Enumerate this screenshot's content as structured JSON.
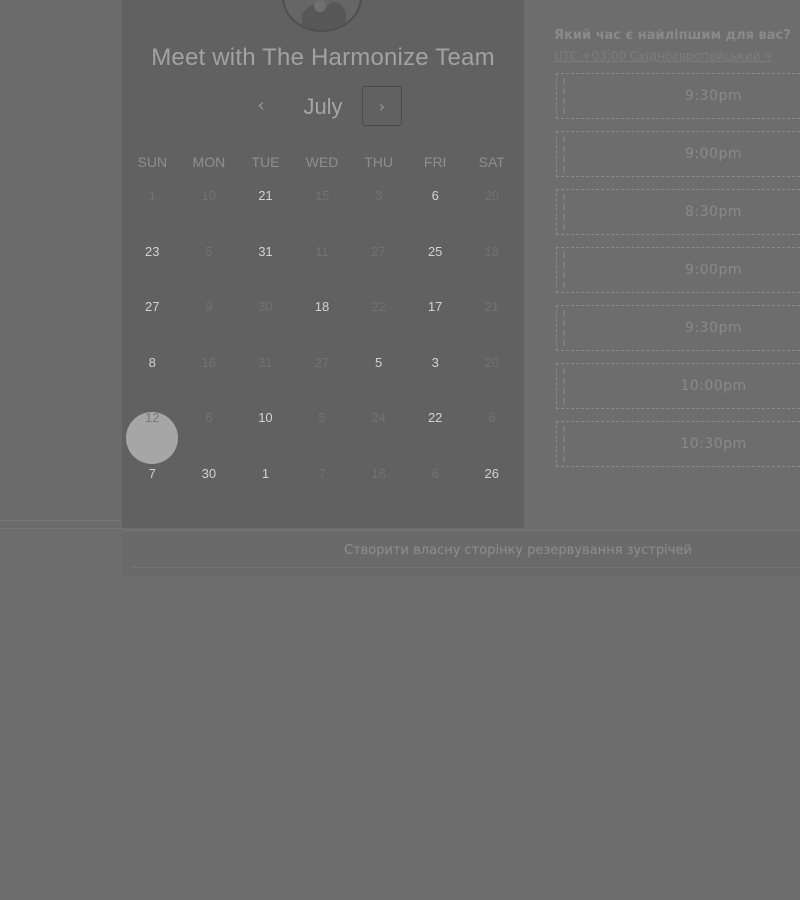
{
  "booking": {
    "title": "Meet with The Harmonize Team",
    "month": "July",
    "prev_icon": "‹",
    "next_icon": "›"
  },
  "weekdays": [
    "SUN",
    "MON",
    "TUE",
    "WED",
    "THU",
    "FRI",
    "SAT"
  ],
  "weeks": [
    [
      {
        "d": "1",
        "s": "dim"
      },
      {
        "d": "10",
        "s": "dim"
      },
      {
        "d": "21",
        "s": "bright"
      },
      {
        "d": "15",
        "s": "dim"
      },
      {
        "d": "3",
        "s": "dim"
      },
      {
        "d": "6",
        "s": "bright"
      },
      {
        "d": "20",
        "s": "dim"
      }
    ],
    [
      {
        "d": "23",
        "s": "bright"
      },
      {
        "d": "5",
        "s": "dim"
      },
      {
        "d": "31",
        "s": "bright"
      },
      {
        "d": "11",
        "s": "dim"
      },
      {
        "d": "27",
        "s": "dim"
      },
      {
        "d": "25",
        "s": "bright"
      },
      {
        "d": "18",
        "s": "dim"
      }
    ],
    [
      {
        "d": "27",
        "s": "bright"
      },
      {
        "d": "9",
        "s": "dim"
      },
      {
        "d": "30",
        "s": "dim"
      },
      {
        "d": "18",
        "s": "bright"
      },
      {
        "d": "22",
        "s": "dim"
      },
      {
        "d": "17",
        "s": "bright"
      },
      {
        "d": "21",
        "s": "dim"
      }
    ],
    [
      {
        "d": "8",
        "s": "bright"
      },
      {
        "d": "16",
        "s": "dim"
      },
      {
        "d": "31",
        "s": "dim"
      },
      {
        "d": "27",
        "s": "dim"
      },
      {
        "d": "5",
        "s": "bright"
      },
      {
        "d": "3",
        "s": "bright"
      },
      {
        "d": "20",
        "s": "dim"
      }
    ],
    [
      {
        "d": "12",
        "s": "selected"
      },
      {
        "d": "6",
        "s": "dim"
      },
      {
        "d": "10",
        "s": "bright"
      },
      {
        "d": "5",
        "s": "dim"
      },
      {
        "d": "24",
        "s": "dim"
      },
      {
        "d": "22",
        "s": "bright"
      },
      {
        "d": "6",
        "s": "dim"
      }
    ],
    [
      {
        "d": "7",
        "s": "bright"
      },
      {
        "d": "30",
        "s": "bright"
      },
      {
        "d": "1",
        "s": "bright"
      },
      {
        "d": "7",
        "s": "dim"
      },
      {
        "d": "18",
        "s": "dim"
      },
      {
        "d": "6",
        "s": "dim"
      },
      {
        "d": "26",
        "s": "bright"
      }
    ]
  ],
  "times": {
    "heading": "Який час є найліпшим для вас?",
    "timezone": "UTC +03:00 Східноєвропейський ч",
    "slots": [
      "9:30pm",
      "9:00pm",
      "8:30pm",
      "9:00pm",
      "9:30pm",
      "10:00pm",
      "10:30pm"
    ]
  },
  "footer": {
    "link": "Створити власну сторінку резервування зустрічей"
  }
}
